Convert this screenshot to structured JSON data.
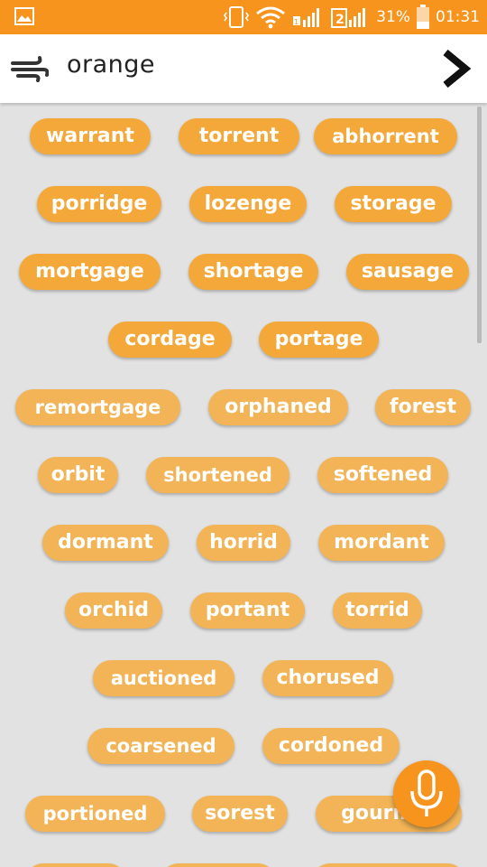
{
  "status_bar": {
    "battery_percent": "31%",
    "time": "01:31",
    "sim_badge": "2"
  },
  "search": {
    "query": "orange"
  },
  "colors": {
    "accent": "#f7941d",
    "chip": "#f4a83a",
    "chip_light": "#f2b457",
    "background": "#e2e2e2"
  },
  "words": [
    "warrant",
    "torrent",
    "abhorrent",
    "porridge",
    "lozenge",
    "storage",
    "mortgage",
    "shortage",
    "sausage",
    "cordage",
    "portage",
    "remortgage",
    "orphaned",
    "forest",
    "orbit",
    "shortened",
    "softened",
    "dormant",
    "horrid",
    "mordant",
    "orchid",
    "portant",
    "torrid",
    "auctioned",
    "chorused",
    "coarsened",
    "cordoned",
    "portioned",
    "sorest",
    "gourmet"
  ]
}
